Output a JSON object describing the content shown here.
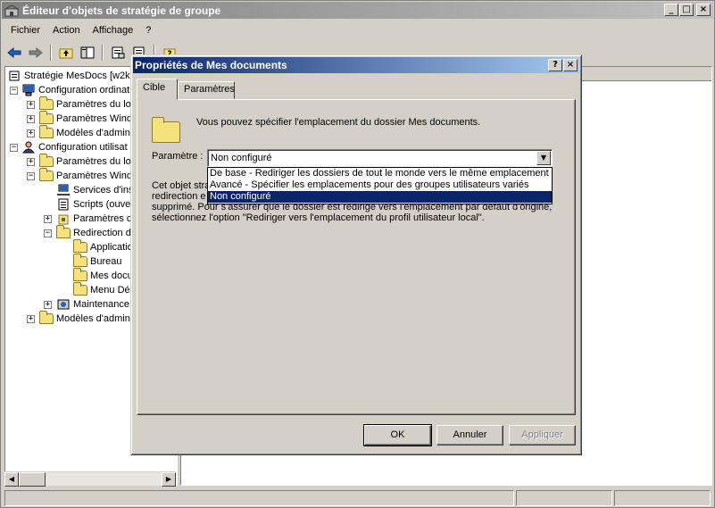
{
  "main_window": {
    "title": "Éditeur d'objets de stratégie de groupe",
    "controls": {
      "minimize": "_",
      "maximize": "□",
      "close": "×"
    }
  },
  "menu": {
    "file": "Fichier",
    "action": "Action",
    "view": "Affichage",
    "help": "?"
  },
  "tree": {
    "items": [
      {
        "label": "Stratégie MesDocs [w2k3",
        "level": 0
      },
      {
        "label": "Configuration ordinat",
        "level": 1
      },
      {
        "label": "Paramètres du lo",
        "level": 2
      },
      {
        "label": "Paramètres Wind",
        "level": 2
      },
      {
        "label": "Modèles d'admini",
        "level": 2
      },
      {
        "label": "Configuration utilisat",
        "level": 1
      },
      {
        "label": "Paramètres du lo",
        "level": 2
      },
      {
        "label": "Paramètres Wind",
        "level": 2
      },
      {
        "label": "Services d'ins",
        "level": 3
      },
      {
        "label": "Scripts (ouve",
        "level": 3
      },
      {
        "label": "Paramètres c",
        "level": 3
      },
      {
        "label": "Redirection d",
        "level": 3
      },
      {
        "label": "Applicatio",
        "level": 4
      },
      {
        "label": "Bureau",
        "level": 4
      },
      {
        "label": "Mes docu",
        "level": 4
      },
      {
        "label": "Menu Dé",
        "level": 4
      },
      {
        "label": "Maintenance",
        "level": 3
      },
      {
        "label": "Modèles d'admini",
        "level": 2
      }
    ]
  },
  "dialog": {
    "title": "Propriétés de Mes documents",
    "title_buttons": {
      "help": "?",
      "close": "×"
    },
    "tabs": [
      {
        "label": "Cible"
      },
      {
        "label": "Paramètres"
      }
    ],
    "description": "Vous pouvez spécifier l'emplacement du dossier Mes documents.",
    "setting_label": "Paramètre :",
    "setting_value": "Non configuré",
    "dropdown_options": [
      "De base - Rediriger les dossiers de tout le monde vers le même emplacement",
      "Avancé - Spécifier les emplacements pour des groupes utilisateurs variés",
      "Non configuré"
    ],
    "policy_text": [
      "Cet objet stra",
      "redirection e",
      "supprimé. Pour s'assurer que le dossier est redirigé vers l'emplacement par défaut d'origine,",
      "sélectionnez l'option \"Rediriger vers l'emplacement du profil utilisateur local\"."
    ],
    "buttons": {
      "ok": "OK",
      "cancel": "Annuler",
      "apply": "Appliquer"
    }
  }
}
